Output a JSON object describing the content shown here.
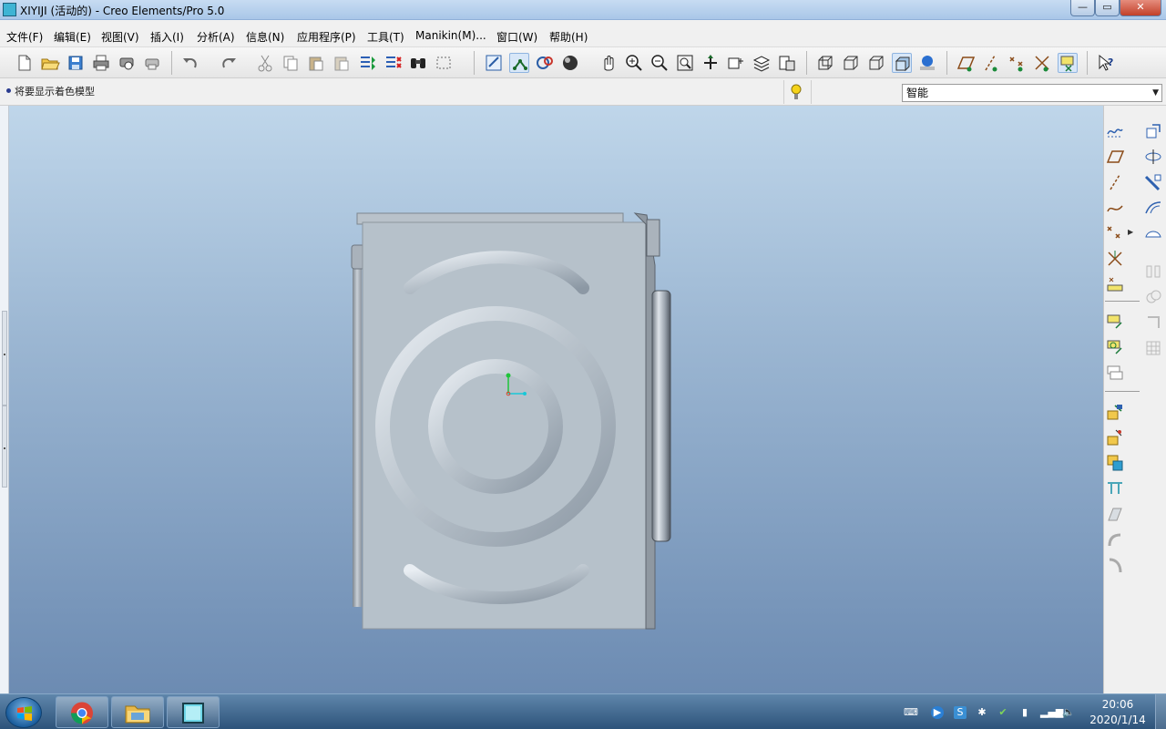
{
  "window": {
    "title": "XIYIJI (活动的) - Creo Elements/Pro 5.0",
    "controls": [
      "minimize",
      "maximize",
      "close"
    ]
  },
  "menu": {
    "items": [
      "文件(F)",
      "编辑(E)",
      "视图(V)",
      "插入(I)",
      "分析(A)",
      "信息(N)",
      "应用程序(P)",
      "工具(T)",
      "Manikin(M)...",
      "窗口(W)",
      "帮助(H)"
    ]
  },
  "toolbar": {
    "icons": [
      "new-file-icon",
      "open-file-icon",
      "save-icon",
      "print-icon",
      "print-preview-icon",
      "print-setup-icon",
      "undo-icon",
      "redo-icon",
      "cut-icon",
      "copy-icon",
      "paste-icon",
      "paste-special-icon",
      "regenerate-icon",
      "regenerate-manager-icon",
      "find-icon",
      "select-box-icon",
      "repaint-icon",
      "spin-center-icon",
      "orient-mode-icon",
      "shading-icon",
      "pan-icon",
      "zoom-in-icon",
      "zoom-out-icon",
      "refit-icon",
      "reorient-icon",
      "saved-views-icon",
      "layers-icon",
      "view-manager-icon",
      "wireframe-icon",
      "hidden-line-icon",
      "no-hidden-icon",
      "shaded-display-icon",
      "enhanced-realism-icon",
      "datum-planes-icon",
      "datum-axes-icon",
      "datum-points-icon",
      "coordinate-systems-icon",
      "annotation-display-icon",
      "context-help-icon"
    ]
  },
  "message_bar": {
    "message": "将要显示着色模型",
    "filter": {
      "selected": "智能"
    }
  },
  "right_toolbar": {
    "icons": [
      "sketch-datum-curve-icon",
      "datum-plane-icon",
      "datum-axis-icon",
      "datum-curve-icon",
      "datum-point-icon",
      "coordinate-system-icon",
      "analysis-feature-icon",
      "extrude-icon",
      "revolve-icon",
      "sweep-icon",
      "blend-icon",
      "variable-section-icon",
      "boundary-blend-icon",
      "style-icon",
      "hole-icon",
      "shell-icon",
      "rib-icon",
      "draft-icon",
      "round-icon",
      "chamfer-icon",
      "pattern-icon",
      "mirror-icon",
      "merge-icon",
      "trim-icon",
      "offset-icon",
      "thicken-icon",
      "solidify-icon",
      "intersect-icon",
      "project-icon"
    ]
  },
  "taskbar": {
    "apps": [
      "chrome-icon",
      "file-explorer-icon",
      "creo-icon"
    ],
    "clock": {
      "time": "20:06",
      "date": "2020/1/14"
    }
  }
}
